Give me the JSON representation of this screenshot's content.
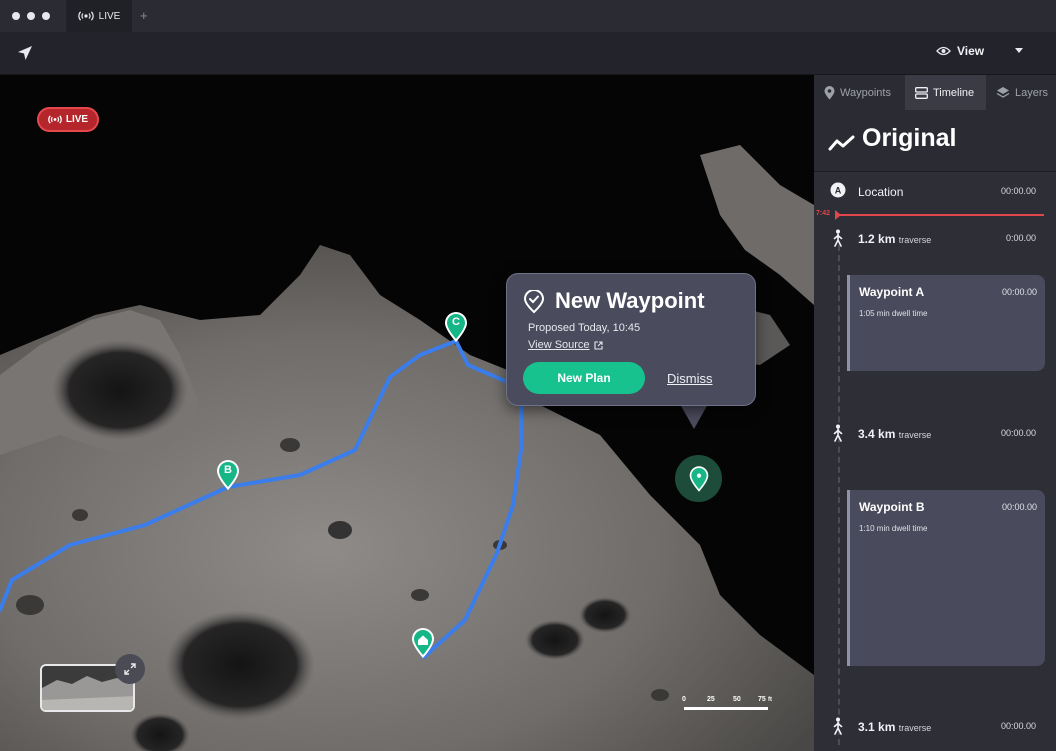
{
  "window": {
    "tab_label": "LIVE",
    "new_tab": "+"
  },
  "toolbar": {
    "view_label": "View"
  },
  "map": {
    "live_label": "LIVE",
    "waypoint_markers": [
      "B",
      "C"
    ],
    "popup": {
      "title": "New Waypoint",
      "subtitle": "Proposed Today, 10:45",
      "link": "View Source",
      "primary_button": "New Plan",
      "secondary_button": "Dismiss"
    },
    "scale": {
      "ticks": [
        "0",
        "25",
        "50",
        "75"
      ],
      "unit": "ft"
    }
  },
  "panel": {
    "tabs": [
      {
        "label": "Waypoints",
        "icon": "pin-icon"
      },
      {
        "label": "Timeline",
        "icon": "timeline-icon"
      },
      {
        "label": "Layers",
        "icon": "layers-icon"
      }
    ],
    "title": "Original",
    "location": {
      "label": "Location",
      "time": "00:00.00",
      "marker": "A"
    },
    "now_marker": "7:42",
    "items": [
      {
        "distance": "1.2 km",
        "kind": "traverse",
        "time": "0:00.00"
      },
      {
        "title": "Waypoint A",
        "time": "00:00.00",
        "detail": "1:05 min dwell time"
      },
      {
        "distance": "3.4 km",
        "kind": "traverse",
        "time": "00:00.00"
      },
      {
        "title": "Waypoint B",
        "time": "00:00.00",
        "detail": "1:10 min dwell time"
      },
      {
        "distance": "3.1 km",
        "kind": "traverse",
        "time": "00:00.00"
      }
    ]
  },
  "colors": {
    "accent": "#17c28e",
    "live": "#b4262c",
    "route": "#3b7dea",
    "now_line": "#e0464a"
  }
}
